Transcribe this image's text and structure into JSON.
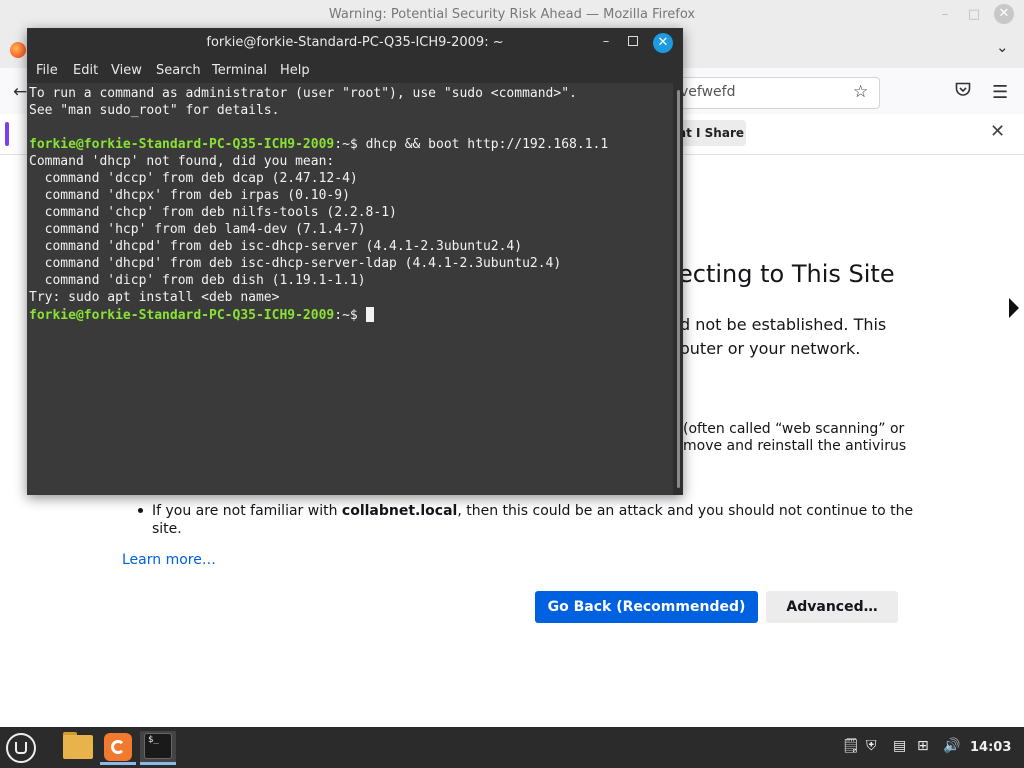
{
  "firefox": {
    "window_title": "Warning: Potential Security Risk Ahead — Mozilla Firefox",
    "url_fragment": "vefwefd",
    "notification_share_label": "at I Share",
    "heading_fragment": "ecting to This Site",
    "para1_line1": "d not be established. This",
    "para1_line2": "outer or your network.",
    "para2_line1": "(often called “web scanning” or",
    "para2_line2": "move and reinstall the antivirus",
    "bullet_prefix": "If you are not familiar with ",
    "bullet_host": "collabnet.local",
    "bullet_suffix": ", then this could be an attack and you should not continue to the",
    "bullet_line2": "site.",
    "learn_more": "Learn more…",
    "go_back_button": "Go Back (Recommended)",
    "advanced_button": "Advanced…"
  },
  "terminal": {
    "title": "forkie@forkie-Standard-PC-Q35-ICH9-2009: ~",
    "menu": [
      "File",
      "Edit",
      "View",
      "Search",
      "Terminal",
      "Help"
    ],
    "prompt": "forkie@forkie-Standard-PC-Q35-ICH9-2009",
    "prompt_suffix": ":~$ ",
    "lines": [
      "To run a command as administrator (user \"root\"), use \"sudo <command>\".",
      "See \"man sudo_root\" for details.",
      "",
      "dhcp && boot http://192.168.1.1",
      "Command 'dhcp' not found, did you mean:",
      "  command 'dccp' from deb dcap (2.47.12-4)",
      "  command 'dhcpx' from deb irpas (0.10-9)",
      "  command 'chcp' from deb nilfs-tools (2.2.8-1)",
      "  command 'hcp' from deb lam4-dev (7.1.4-7)",
      "  command 'dhcpd' from deb isc-dhcp-server (4.4.1-2.3ubuntu2.4)",
      "  command 'dhcpd' from deb isc-dhcp-server-ldap (4.4.1-2.3ubuntu2.4)",
      "  command 'dicp' from deb dish (1.19.1-1.1)",
      "Try: sudo apt install <deb name>"
    ]
  },
  "taskbar": {
    "terminal_icon_text": "$_",
    "clock": "14:03"
  },
  "icons": {
    "ff_minimize": "minimize-icon",
    "ff_maximize": "maximize-icon",
    "ff_close": "close-icon",
    "star": "star-icon",
    "pocket": "pocket-icon",
    "menu": "hamburger-menu-icon",
    "volume": "volume-icon",
    "network": "network-icon"
  },
  "colors": {
    "prompt_green": "#8ae234",
    "link_blue": "#0061e0",
    "primary_button": "#0061e0",
    "terminal_bg": "#3a3a3a",
    "close_blue": "#1e9be0"
  }
}
